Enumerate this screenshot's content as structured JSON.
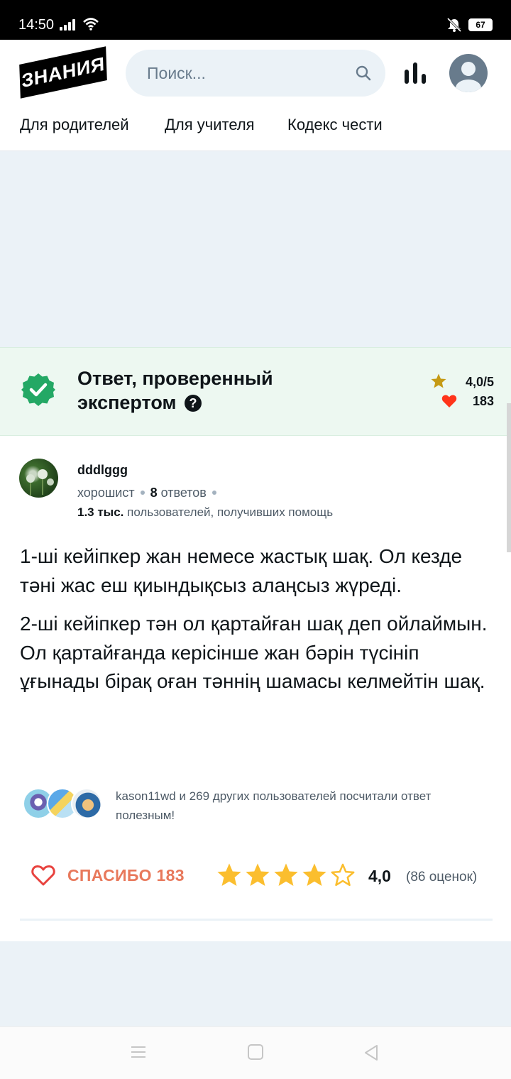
{
  "status_bar": {
    "time": "14:50",
    "battery": "67"
  },
  "header": {
    "logo": "ЗНАНИЯ",
    "search_placeholder": "Поиск...",
    "nav": [
      "Для родителей",
      "Для учителя",
      "Кодекс чести"
    ]
  },
  "verified_answer": {
    "title": "Ответ, проверенный экспертом",
    "rating": "4,0/5",
    "likes": "183",
    "help_icon": "?"
  },
  "author": {
    "name": "dddlggg",
    "rank": "хорошист",
    "answers_count": "8",
    "answers_label": "ответов",
    "helped_count": "1.3 тыс.",
    "helped_label": "пользователей, получивших помощь"
  },
  "answer": {
    "paragraphs": [
      "1-ші кейіпкер жан немесе жастық шақ. Ол кезде тәні жас еш қиындықсыз алаңсыз жүреді.",
      "2-ші кейіпкер тән ол қартайған шақ деп ойлаймын. Ол қартайғанда керісінше жан бәрін түсініп ұғынады бірақ оған тәннің шамасы келмейтін шақ."
    ]
  },
  "helpful": {
    "text": "kason11wd и 269 других пользователей посчитали ответ полезным!"
  },
  "actions": {
    "thanks_label": "СПАСИБО 183",
    "stars_filled": 4,
    "stars_total": 5,
    "score": "4,0",
    "votes": "(86 оценок)"
  },
  "colors": {
    "accent_green": "#24a865",
    "star_gold": "#fbbe2e",
    "heart_red": "#ff341a",
    "thanks_coral": "#e8795c",
    "page_bg_blue": "#ebf2f7"
  },
  "icons": {
    "search": "search-icon",
    "stats": "stats-icon",
    "avatar": "user-avatar-icon",
    "verified": "verified-badge-icon",
    "star": "star-icon",
    "heart": "heart-icon"
  }
}
